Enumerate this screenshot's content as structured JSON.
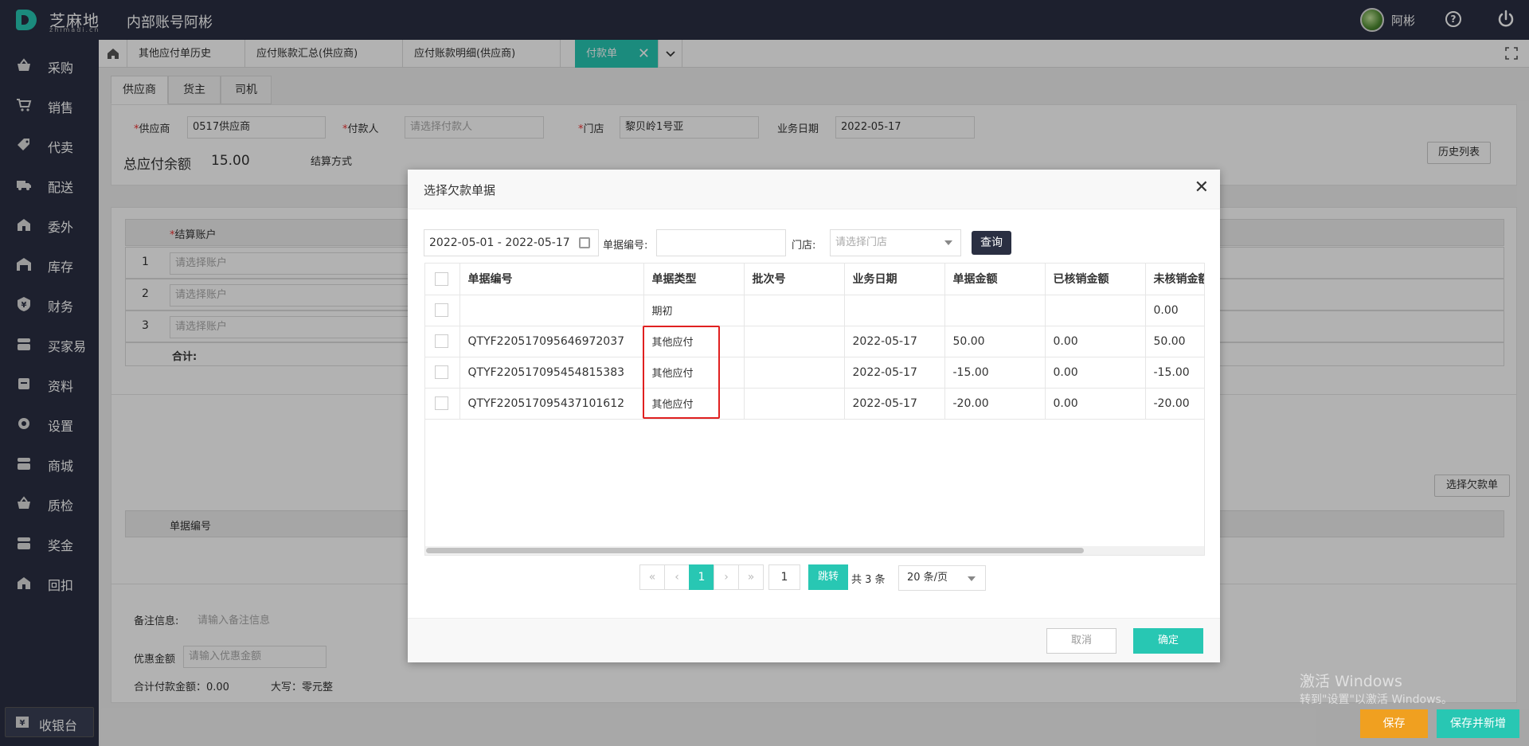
{
  "header": {
    "brand": "芝麻地",
    "brand_sub": "zhimadi.cn",
    "app_title": "内部账号阿彬",
    "user_name": "阿彬"
  },
  "sidebar": {
    "items": [
      {
        "label": "采购",
        "icon": "basket-icon"
      },
      {
        "label": "销售",
        "icon": "cart-icon"
      },
      {
        "label": "代卖",
        "icon": "tag-icon"
      },
      {
        "label": "配送",
        "icon": "truck-icon"
      },
      {
        "label": "委外",
        "icon": "building-icon"
      },
      {
        "label": "库存",
        "icon": "warehouse-icon"
      },
      {
        "label": "财务",
        "icon": "yen-icon"
      },
      {
        "label": "买家易",
        "icon": "store-icon"
      },
      {
        "label": "资料",
        "icon": "archive-icon"
      },
      {
        "label": "设置",
        "icon": "gear-icon"
      },
      {
        "label": "商城",
        "icon": "mall-icon"
      },
      {
        "label": "质检",
        "icon": "inspect-icon"
      },
      {
        "label": "奖金",
        "icon": "bonus-icon"
      },
      {
        "label": "回扣",
        "icon": "rebate-icon"
      }
    ],
    "cashier": "收银台"
  },
  "tabs": [
    {
      "label": "其他应付单历史"
    },
    {
      "label": "应付账款汇总(供应商)"
    },
    {
      "label": "应付账款明细(供应商)"
    },
    {
      "label": "付款单"
    }
  ],
  "form": {
    "sec_tabs": [
      "供应商",
      "货主",
      "司机"
    ],
    "supplier_label": "供应商",
    "supplier_value": "0517供应商",
    "payer_label": "付款人",
    "payer_placeholder": "请选择付款人",
    "store_label": "门店",
    "store_value": "黎贝岭1号亚",
    "date_label": "业务日期",
    "date_value": "2022-05-17",
    "total_label": "总应付余额",
    "total_value": "15.00",
    "settle_label": "结算方式",
    "history_btn": "历史列表",
    "account_header": "结算账户",
    "account_rows": [
      {
        "no": "1",
        "placeholder": "请选择账户"
      },
      {
        "no": "2",
        "placeholder": "请选择账户"
      },
      {
        "no": "3",
        "placeholder": "请选择账户"
      }
    ],
    "sum_label": "合计:",
    "select_debt_btn": "选择欠款单",
    "doc_no_header": "单据编号",
    "remark_label": "备注信息:",
    "remark_placeholder": "请输入备注信息",
    "discount_label": "优惠金额",
    "discount_placeholder": "请输入优惠金额",
    "total_pay_label": "合计付款金额：0.00",
    "capital_label": "大写：零元整"
  },
  "modal": {
    "title": "选择欠款单据",
    "date_range": "2022-05-01 - 2022-05-17",
    "doc_no_label": "单据编号:",
    "store_label": "门店:",
    "store_placeholder": "请选择门店",
    "query_btn": "查询",
    "columns": [
      "单据编号",
      "单据类型",
      "批次号",
      "业务日期",
      "单据金额",
      "已核销金额",
      "未核销金额"
    ],
    "rows": [
      {
        "doc_no": "",
        "type": "期初",
        "batch": "",
        "date": "",
        "amount": "",
        "verified": "",
        "unverified": "0.00"
      },
      {
        "doc_no": "QTYF220517095646972037",
        "type": "其他应付",
        "batch": "",
        "date": "2022-05-17",
        "amount": "50.00",
        "verified": "0.00",
        "unverified": "50.00"
      },
      {
        "doc_no": "QTYF220517095454815383",
        "type": "其他应付",
        "batch": "",
        "date": "2022-05-17",
        "amount": "-15.00",
        "verified": "0.00",
        "unverified": "-15.00"
      },
      {
        "doc_no": "QTYF220517095437101612",
        "type": "其他应付",
        "batch": "",
        "date": "2022-05-17",
        "amount": "-20.00",
        "verified": "0.00",
        "unverified": "-20.00"
      }
    ],
    "pager": {
      "current": "1",
      "jump_value": "1",
      "jump_btn": "跳转",
      "total": "共 3 条",
      "page_size": "20 条/页"
    },
    "cancel_btn": "取消",
    "ok_btn": "确定"
  },
  "footer": {
    "watermark_title": "激活 Windows",
    "watermark_sub": "转到\"设置\"以激活 Windows。",
    "save_btn": "保存",
    "save_new_btn": "保存并新增"
  },
  "colors": {
    "accent": "#28c7b3",
    "dark": "#2a2f42",
    "highlight": "#e02020",
    "save": "#f0a020"
  }
}
